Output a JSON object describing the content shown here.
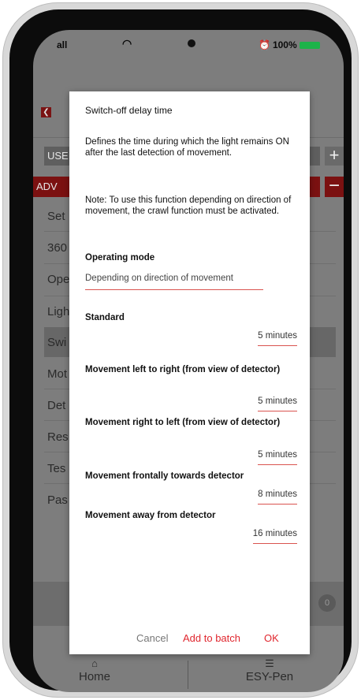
{
  "status_bar": {
    "signal": "all",
    "battery": "100%"
  },
  "background_app": {
    "section_user": "USE",
    "section_advanced": "ADV",
    "rows": [
      "Set",
      "360",
      "Ope",
      "Ligh",
      "Swi",
      "Mot",
      "Det",
      "Res",
      "Tes",
      "Pas"
    ],
    "bottom_badge": "0",
    "tabs": [
      {
        "label": "Home",
        "icon": "home-icon"
      },
      {
        "label": "ESY-Pen",
        "icon": "sliders-icon"
      }
    ]
  },
  "dialog": {
    "title": "Switch-off delay time",
    "description": "Defines the time during which the light remains ON after the last detection of movement.",
    "note": "Note: To use this function depending on direction of movement, the crawl function must be activated.",
    "operating_mode": {
      "label": "Operating mode",
      "value": "Depending on direction of movement"
    },
    "fields": [
      {
        "label": "Standard",
        "value": "5 minutes"
      },
      {
        "label": "Movement left to right (from view of detector)",
        "value": "5 minutes"
      },
      {
        "label": "Movement right to left (from view of detector)",
        "value": "5 minutes"
      },
      {
        "label": "Movement frontally towards detector",
        "value": "8 minutes"
      },
      {
        "label": "Movement away from detector",
        "value": "16 minutes"
      }
    ],
    "actions": {
      "cancel": "Cancel",
      "add_to_batch": "Add to batch",
      "ok": "OK"
    }
  },
  "colors": {
    "accent": "#e0262e",
    "battery": "#1db34a"
  }
}
